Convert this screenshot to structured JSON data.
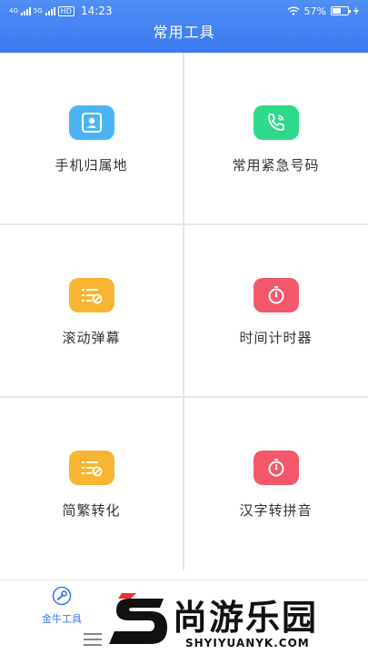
{
  "status_bar": {
    "net1": "4G",
    "net2": "5G",
    "hd": "HD",
    "time": "14:23",
    "battery_percent": "57%",
    "battery_level": 0.57
  },
  "header": {
    "title": "常用工具"
  },
  "tools": [
    {
      "label": "手机归属地",
      "icon": "contact-card-icon",
      "color": "#4cb4f5"
    },
    {
      "label": "常用紧急号码",
      "icon": "phone-call-icon",
      "color": "#2fd98a"
    },
    {
      "label": "滚动弹幕",
      "icon": "list-edit-icon",
      "color": "#f7b531"
    },
    {
      "label": "时间计时器",
      "icon": "stopwatch-icon",
      "color": "#f2576a"
    },
    {
      "label": "简繁转化",
      "icon": "list-edit-icon",
      "color": "#f7b531"
    },
    {
      "label": "汉字转拼音",
      "icon": "stopwatch-icon",
      "color": "#f2576a"
    }
  ],
  "bottom_nav": {
    "home_label": "金牛工具",
    "accent": "#3a78ef"
  },
  "watermark": {
    "text": "尚游乐园",
    "url": "SHYIYUANYK.COM"
  }
}
